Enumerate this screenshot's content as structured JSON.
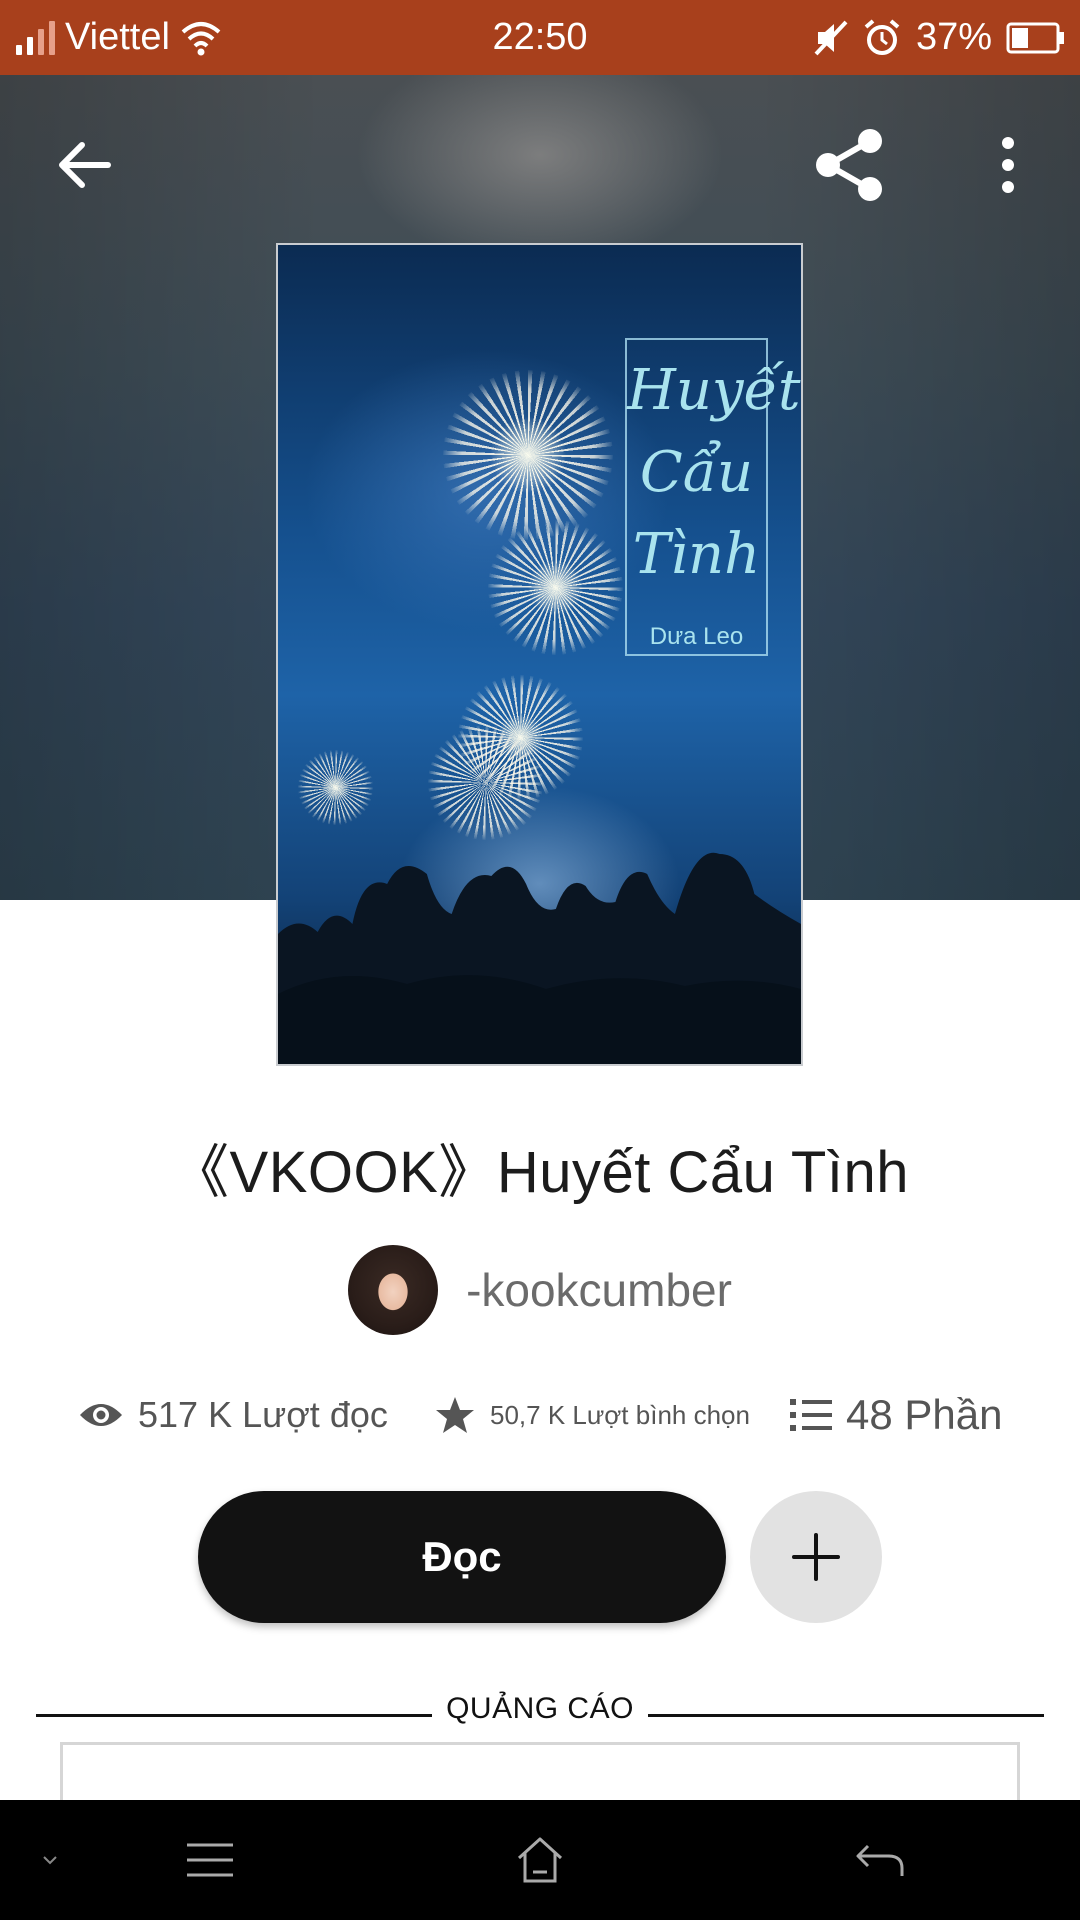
{
  "status_bar": {
    "carrier": "Viettel",
    "time": "22:50",
    "battery": "37%",
    "icons": [
      "signal-icon",
      "wifi-icon",
      "mute-icon",
      "alarm-icon",
      "battery-icon"
    ]
  },
  "toolbar": {
    "icons": [
      "back-arrow-icon",
      "share-icon",
      "more-vertical-icon"
    ]
  },
  "cover": {
    "title_line1": "Huyết",
    "title_line2": "Cẩu",
    "title_line3": "Tình",
    "author": "Dưa Leo"
  },
  "book": {
    "title": "《VKOOK》Huyết Cẩu Tình",
    "author": "-kookcumber"
  },
  "stats": {
    "reads": "517 K Lượt đọc",
    "votes": "50,7 K Lượt bình chọn",
    "parts": "48 Phần"
  },
  "actions": {
    "read_label": "Đọc",
    "add_icon": "plus-icon"
  },
  "ad": {
    "label": "QUẢNG CÁO"
  },
  "nav": {
    "icons": [
      "chevron-down-icon",
      "menu-icon",
      "home-icon",
      "back-icon"
    ]
  },
  "colors": {
    "status_bar": "#a8401c",
    "read_button": "#121212",
    "add_button": "#e2e2e2"
  }
}
